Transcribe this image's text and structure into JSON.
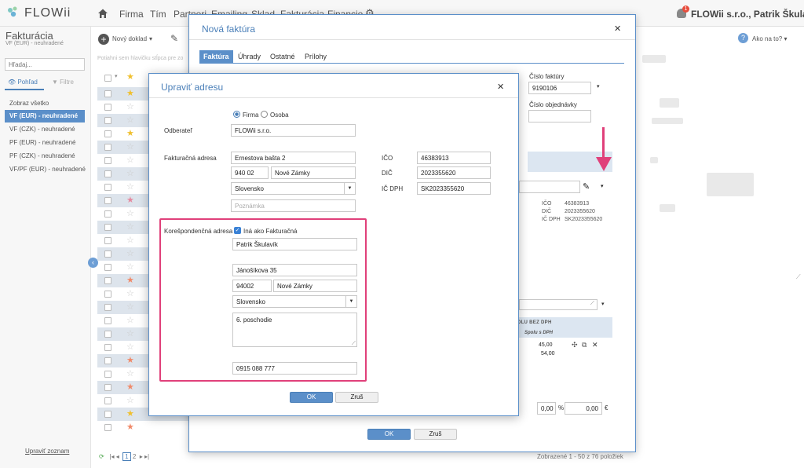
{
  "topbar": {
    "logo_text": "FLOWii",
    "nav": [
      "Firma",
      "Tím",
      "Partneri",
      "Emailing",
      "Sklad",
      "Fakturácia",
      "Financie"
    ],
    "notification_count": "1",
    "company_user": "FLOWii s.r.o., Patrik Škulavík"
  },
  "sidebar": {
    "title": "Fakturácia",
    "subtitle": "VF (EUR) - neuhradené",
    "search_placeholder": "Hľadaj...",
    "tab_view": "Pohľad",
    "tab_filter": "Filtre",
    "items": [
      "Zobraz všetko",
      "VF (EUR) - neuhradené",
      "VF (CZK) - neuhradené",
      "PF (EUR) - neuhradené",
      "PF (CZK) - neuhradené",
      "VF/PF (EUR) - neuhradené"
    ],
    "active_index": 1,
    "bottom_link": "Upraviť zoznam"
  },
  "list": {
    "new_doc": "Nový doklad",
    "hint": "Potiahni sem hlavičku stĺpca pre zo",
    "help": "Ako na to?",
    "pager_prev": "|◂  ◂",
    "page_1": "1",
    "page_2": "2",
    "pager_next": "▸  ▸|",
    "pager_info": "Zobrazené 1 - 50 z 76 položiek",
    "row_stars": [
      "y",
      "n",
      "n",
      "y",
      "n",
      "n",
      "n",
      "n",
      "p",
      "n",
      "n",
      "n",
      "n",
      "n",
      "o",
      "n",
      "n",
      "n",
      "n",
      "n",
      "o",
      "n",
      "o",
      "n",
      "y",
      "o"
    ]
  },
  "invoice_dialog": {
    "title": "Nová faktúra",
    "tabs": [
      "Faktúra",
      "Úhrady",
      "Ostatné",
      "Prílohy"
    ],
    "invoice_number_label": "Číslo faktúry",
    "invoice_number": "9190106",
    "order_number_label": "Číslo objednávky",
    "ico_label": "IČO",
    "ico": "46383913",
    "dic_label": "DIČ",
    "dic": "2023355620",
    "icdph_label": "IČ DPH",
    "icdph": "SK2023355620",
    "table_h1": "SPOLU BEZ DPH",
    "table_h2": "Spolu s DPH",
    "total_1": "45,00",
    "total_2": "54,00",
    "discount": "0,00",
    "percent": "%",
    "amount": "0,00",
    "currency": "€",
    "ok": "OK",
    "cancel": "Zruš"
  },
  "address_dialog": {
    "title": "Upraviť adresu",
    "radio_firma": "Firma",
    "radio_osoba": "Osoba",
    "odberatel_label": "Odberateľ",
    "odberatel": "FLOWii s.r.o.",
    "billing_label": "Fakturačná adresa",
    "street": "Ernestova bašta 2",
    "zip": "940 02",
    "city": "Nové Zámky",
    "country": "Slovensko",
    "note_placeholder": "Poznámka",
    "ico_label": "IČO",
    "ico": "46383913",
    "dic_label": "DIČ",
    "dic": "2023355620",
    "icdph_label": "IČ DPH",
    "icdph": "SK2023355620",
    "corr_label": "Korešpondenčná adresa",
    "corr_checkbox": "Iná ako Fakturačná",
    "corr_name": "Patrik Škulavík",
    "corr_street": "Jánošíkova 35",
    "corr_zip": "94002",
    "corr_city": "Nové Zámky",
    "corr_country": "Slovensko",
    "corr_note": "6. poschodie",
    "corr_phone": "0915 088 777",
    "ok": "OK",
    "cancel": "Zruš"
  },
  "colors": {
    "accent": "#5b8fc9",
    "highlight": "#e0407a"
  }
}
